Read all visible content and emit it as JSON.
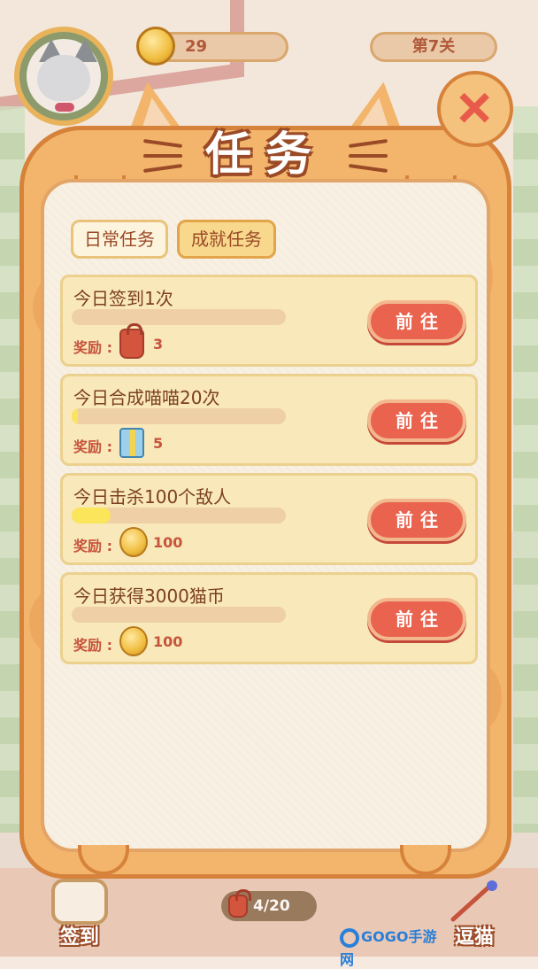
{
  "hud": {
    "coins": "29",
    "level": "第7关"
  },
  "modal": {
    "title": "任务",
    "close_glyph": "+"
  },
  "tabs": [
    {
      "label": "日常任务",
      "active": false
    },
    {
      "label": "成就任务",
      "active": true
    }
  ],
  "reward_label": "奖励 :",
  "go_label": "前往",
  "tasks": [
    {
      "title": "今日签到1次",
      "progress": 0.0,
      "reward_icon": "bag-icon",
      "reward": "3"
    },
    {
      "title": "今日合成喵喵20次",
      "progress": 0.03,
      "reward_icon": "gift-box-icon",
      "reward": "5"
    },
    {
      "title": "今日击杀100个敌人",
      "progress": 0.18,
      "reward_icon": "coin-icon",
      "reward": "100"
    },
    {
      "title": "今日获得3000猫币",
      "progress": 0.0,
      "reward_icon": "coin-icon",
      "reward": "100"
    }
  ],
  "bottom": {
    "sign_in": "签到",
    "counter": "4/20",
    "tease_cat": "逗猫",
    "watermark": "GOGO手游网"
  },
  "colors": {
    "frame": "#f2b56b",
    "panel": "#f8f0e2",
    "card": "#f8e8ba",
    "go_button": "#e9634e",
    "progress_fill": "#fbe55b"
  }
}
